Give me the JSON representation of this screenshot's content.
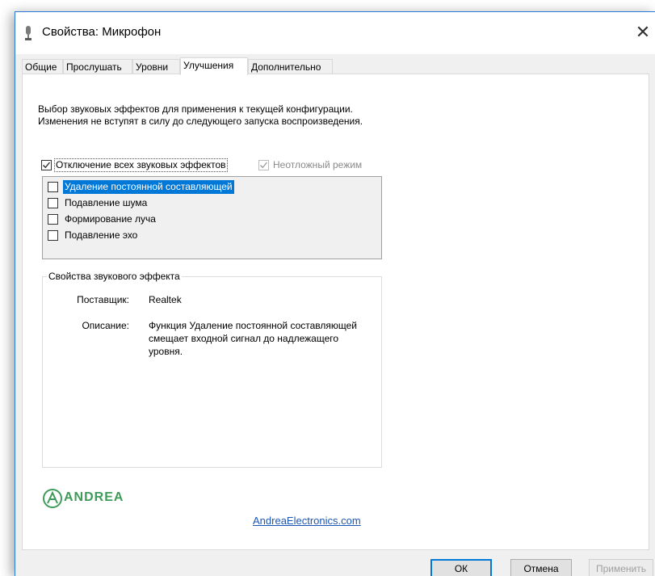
{
  "window": {
    "title": "Свойства: Микрофон",
    "close_glyph": "✕",
    "icon": "microphone-icon"
  },
  "tabs": [
    {
      "label": "Общие",
      "active": false
    },
    {
      "label": "Прослушать",
      "active": false
    },
    {
      "label": "Уровни",
      "active": false
    },
    {
      "label": "Улучшения",
      "active": true
    },
    {
      "label": "Дополнительно",
      "active": false
    }
  ],
  "enhancements": {
    "description": "Выбор звуковых эффектов для применения к текущей конфигурации. Изменения не вступят в силу до следующего запуска воспроизведения.",
    "disable_all": {
      "label": "Отключение всех звуковых эффектов",
      "checked": true
    },
    "immediate_mode": {
      "label": "Неотложный режим",
      "checked": true,
      "enabled": false
    },
    "effects": [
      {
        "label": "Удаление постоянной составляющей",
        "checked": false,
        "selected": true
      },
      {
        "label": "Подавление шума",
        "checked": false,
        "selected": false
      },
      {
        "label": "Формирование луча",
        "checked": false,
        "selected": false
      },
      {
        "label": "Подавление эхо",
        "checked": false,
        "selected": false
      }
    ]
  },
  "effect_properties": {
    "group_title": "Свойства звукового эффекта",
    "provider_label": "Поставщик:",
    "provider_value": "Realtek",
    "description_label": "Описание:",
    "description_value": "Функция Удаление постоянной составляющей смещает входной сигнал до надлежащего уровня."
  },
  "branding": {
    "logo_text": "ANDREA",
    "link_text": "AndreaElectronics.com",
    "color": "#3e9b5a"
  },
  "buttons": {
    "ok": "ОК",
    "cancel": "Отмена",
    "apply": "Применить"
  },
  "colors": {
    "selection": "#0078d7",
    "window_border": "#2b79d8",
    "link": "#1a55b5"
  }
}
